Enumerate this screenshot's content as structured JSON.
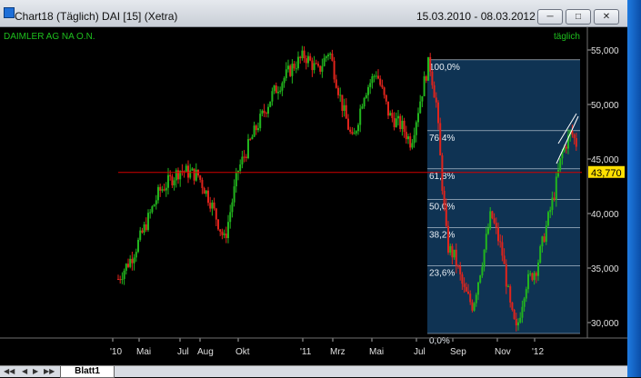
{
  "window": {
    "title": "Chart18 (Täglich)  DAI [15] (Xetra)",
    "date_range": "15.03.2010 - 08.03.2012"
  },
  "chart": {
    "instrument_label": "DAIMLER AG NA O.N.",
    "interval_label": "täglich",
    "price_tag": "43,770",
    "y_axis_labels": [
      "55,000",
      "50,000",
      "45,000",
      "40,000",
      "35,000",
      "30,000"
    ],
    "y_axis_values": [
      55000,
      50000,
      45000,
      40000,
      35000,
      30000
    ],
    "x_axis_labels": [
      "'10",
      "Mai",
      "Jul",
      "Aug",
      "Okt",
      "'11",
      "Mrz",
      "Mai",
      "Jul",
      "Sep",
      "Nov",
      "'12"
    ],
    "fib_labels": [
      "100,0%",
      "76,4%",
      "61,8%",
      "50,0%",
      "38,2%",
      "23,6%",
      "0,0%"
    ],
    "fib_prices": [
      54100,
      47600,
      44100,
      41300,
      38700,
      35200,
      29000
    ],
    "support_line_price": 43770
  },
  "footer": {
    "sheet_tab": "Blatt1"
  },
  "colors": {
    "up_candle": "#22b51e",
    "down_candle": "#e0241c",
    "fib_zone": "#0f3353",
    "support_line": "#d20000",
    "price_tag_bg": "#ffe000",
    "label_green": "#1ec01e"
  }
}
